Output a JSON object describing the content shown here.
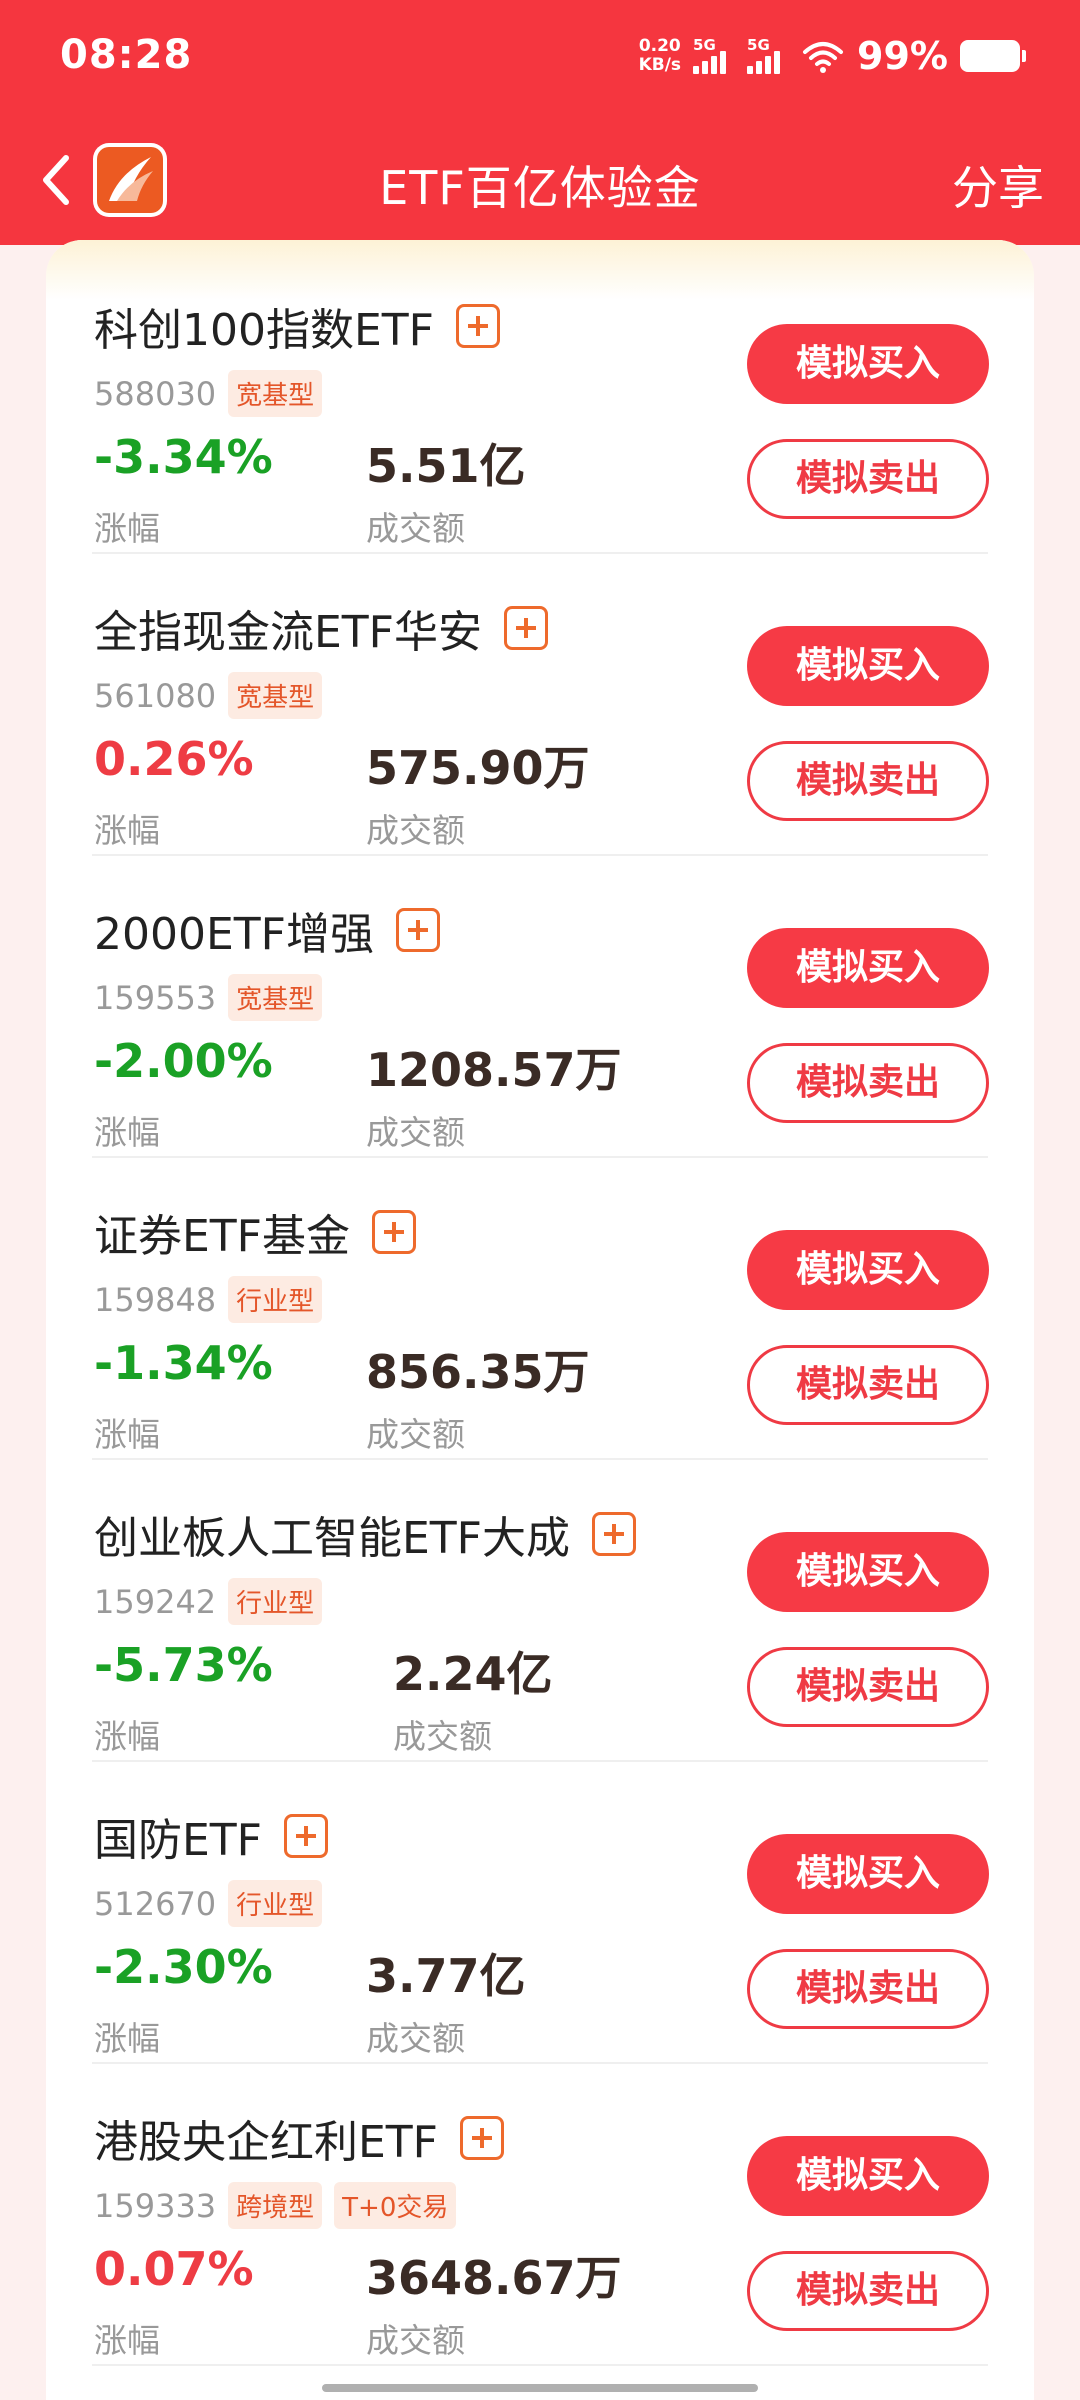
{
  "status_bar": {
    "time": "08:28",
    "net_speed_value": "0.20",
    "net_speed_unit": "KB/s",
    "sim1": "5G",
    "sim2": "5G",
    "battery": "99%"
  },
  "nav": {
    "title": "ETF百亿体验金",
    "share_label": "分享"
  },
  "labels": {
    "change": "涨幅",
    "volume": "成交额",
    "buy": "模拟买入",
    "sell": "模拟卖出"
  },
  "items": [
    {
      "name": "科创100指数ETF",
      "code": "588030",
      "tags": [
        "宽基型"
      ],
      "change": "-3.34%",
      "direction": "down",
      "volume": "5.51亿"
    },
    {
      "name": "全指现金流ETF华安",
      "code": "561080",
      "tags": [
        "宽基型"
      ],
      "change": "0.26%",
      "direction": "up",
      "volume": "575.90万"
    },
    {
      "name": "2000ETF增强",
      "code": "159553",
      "tags": [
        "宽基型"
      ],
      "change": "-2.00%",
      "direction": "down",
      "volume": "1208.57万"
    },
    {
      "name": "证券ETF基金",
      "code": "159848",
      "tags": [
        "行业型"
      ],
      "change": "-1.34%",
      "direction": "down",
      "volume": "856.35万"
    },
    {
      "name": "创业板人工智能ETF大成",
      "code": "159242",
      "tags": [
        "行业型"
      ],
      "change": "-5.73%",
      "direction": "down",
      "volume": "2.24亿"
    },
    {
      "name": "国防ETF",
      "code": "512670",
      "tags": [
        "行业型"
      ],
      "change": "-2.30%",
      "direction": "down",
      "volume": "3.77亿"
    },
    {
      "name": "港股央企红利ETF",
      "code": "159333",
      "tags": [
        "跨境型",
        "T+0交易"
      ],
      "change": "0.07%",
      "direction": "up",
      "volume": "3648.67万"
    }
  ],
  "colors": {
    "header_bg": "#f5363f",
    "down": "#1aa125",
    "up": "#ee3c44",
    "accent": "#ee6a2c"
  }
}
